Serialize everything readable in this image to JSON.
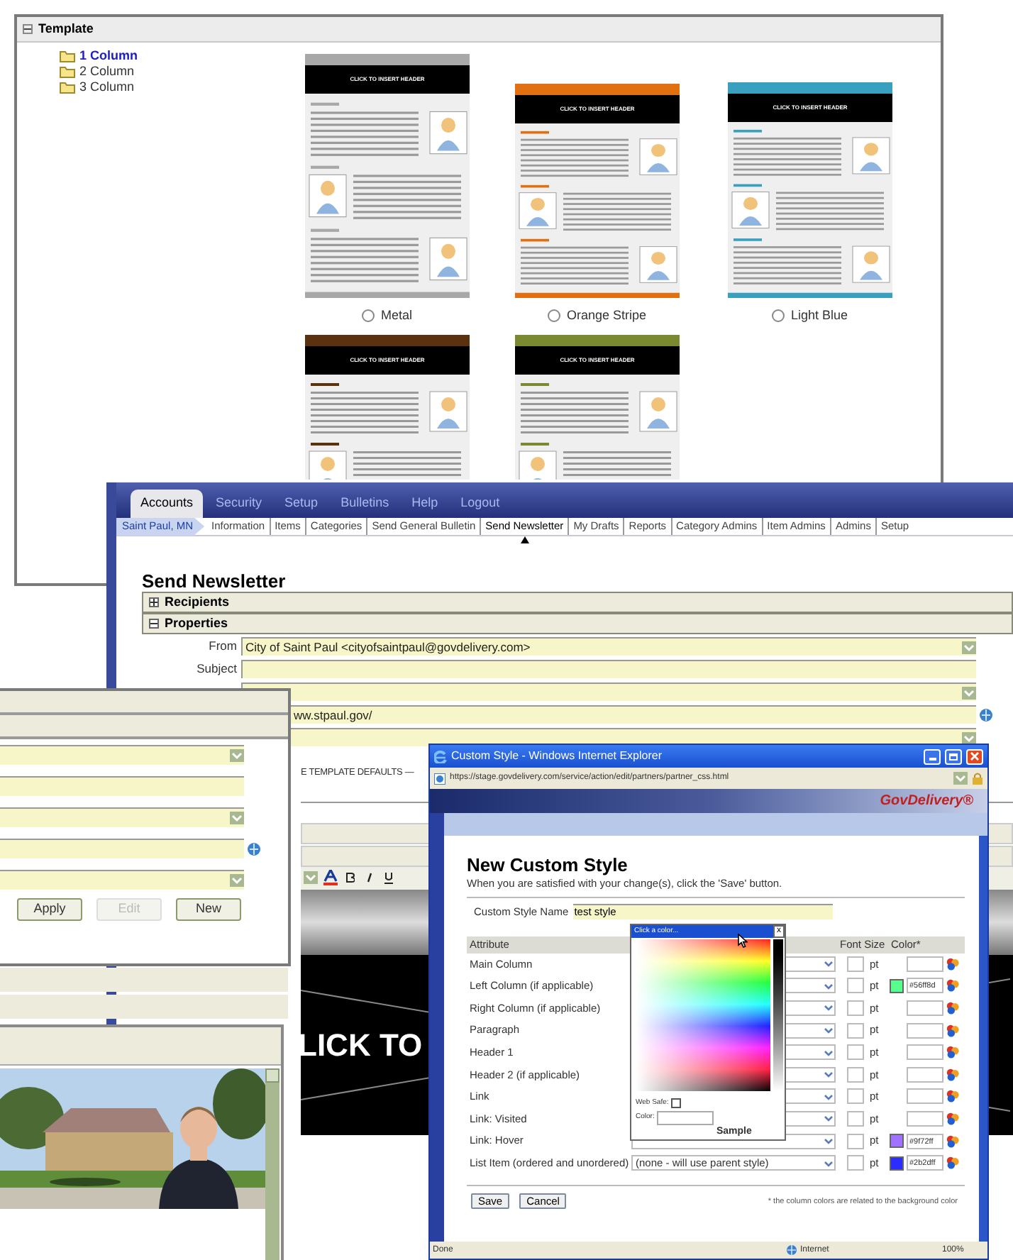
{
  "template_panel": {
    "title": "Template",
    "expanded": true,
    "tree": [
      {
        "label": "1 Column",
        "selected": true
      },
      {
        "label": "2 Column",
        "selected": false
      },
      {
        "label": "3 Column",
        "selected": false
      }
    ],
    "templates": [
      {
        "label": "Metal",
        "selected": false,
        "header_text": "CLICK TO INSERT HEADER",
        "color": "#a8a8a8"
      },
      {
        "label": "Orange Stripe",
        "selected": false,
        "header_text": "CLICK TO INSERT HEADER",
        "color": "#e07010"
      },
      {
        "label": "Light Blue",
        "selected": false,
        "header_text": "CLICK TO INSERT HEADER",
        "color": "#3aa0c0"
      },
      {
        "header_text": "CLICK TO INSERT HEADER",
        "color": "#5a3210"
      },
      {
        "header_text": "CLICK TO INSERT HEADER",
        "color": "#7a8a30"
      }
    ]
  },
  "newsletter_window": {
    "nav_tabs": [
      {
        "label": "Accounts",
        "selected": true
      },
      {
        "label": "Security",
        "selected": false
      },
      {
        "label": "Setup",
        "selected": false
      },
      {
        "label": "Bulletins",
        "selected": false
      },
      {
        "label": "Help",
        "selected": false
      },
      {
        "label": "Logout",
        "selected": false
      }
    ],
    "location": "Saint Paul, MN",
    "subnav": [
      {
        "label": "Information",
        "selected": false
      },
      {
        "label": "Items",
        "selected": false
      },
      {
        "label": "Categories",
        "selected": false
      },
      {
        "label": "Send General Bulletin",
        "selected": false
      },
      {
        "label": "Send Newsletter",
        "selected": true
      },
      {
        "label": "My Drafts",
        "selected": false
      },
      {
        "label": "Reports",
        "selected": false
      },
      {
        "label": "Category Admins",
        "selected": false
      },
      {
        "label": "Item Admins",
        "selected": false
      },
      {
        "label": "Admins",
        "selected": false
      },
      {
        "label": "Setup",
        "selected": false
      }
    ],
    "title": "Send Newsletter",
    "sections": [
      {
        "label": "Recipients",
        "expanded": false
      },
      {
        "label": "Properties",
        "expanded": true
      }
    ],
    "fields": [
      {
        "kind": "select",
        "label": "From",
        "value": "City of Saint Paul <cityofsaintpaul@govdelivery.com>"
      },
      {
        "kind": "text",
        "label": "Subject"
      },
      {
        "kind": "select"
      },
      {
        "kind": "url",
        "value": "ww.stpaul.gov/"
      },
      {
        "kind": "select"
      }
    ],
    "defaults_text": "E TEMPLATE DEFAULTS —",
    "header_image_text": "LICK TO"
  },
  "left_window": {
    "fields": [
      {
        "kind": "select"
      },
      {
        "kind": "text"
      },
      {
        "kind": "select"
      },
      {
        "kind": "url"
      },
      {
        "kind": "select"
      }
    ],
    "buttons": [
      {
        "label": "Apply",
        "disabled": false
      },
      {
        "label": "Edit",
        "disabled": true
      },
      {
        "label": "New",
        "disabled": false
      }
    ]
  },
  "custom_style_window": {
    "title": "Custom Style - Windows Internet Explorer",
    "address": "https://stage.govdelivery.com/service/action/edit/partners/partner_css.html",
    "brand": "GovDelivery®",
    "heading": "New Custom Style",
    "subtitle": "When you are satisfied with your change(s), click the 'Save' button.",
    "name_label": "Custom Style Name",
    "name_value": "test style",
    "columns": [
      "Attribute",
      "Font Size",
      "Color*"
    ],
    "rows": [
      {
        "attribute": "Main Column",
        "unit": "pt"
      },
      {
        "attribute": "Left Column (if applicable)",
        "unit": "pt",
        "color": "#56ff8d",
        "color_value": "#56ff8d"
      },
      {
        "attribute": "Right Column (if applicable)",
        "unit": "pt"
      },
      {
        "attribute": "Paragraph",
        "unit": "pt"
      },
      {
        "attribute": "Header 1",
        "unit": "pt"
      },
      {
        "attribute": "Header 2 (if applicable)",
        "unit": "pt"
      },
      {
        "attribute": "Link",
        "unit": "pt"
      },
      {
        "attribute": "Link: Visited",
        "unit": "pt"
      },
      {
        "attribute": "Link: Hover",
        "unit": "pt",
        "color": "#9f72ff",
        "color_value": "#9f72ff"
      },
      {
        "attribute": "List Item (ordered and unordered)",
        "style": "(none - will use parent style)",
        "unit": "pt",
        "color": "#2b2dff",
        "color_value": "#2b2dff"
      }
    ],
    "buttons": [
      "Save",
      "Cancel"
    ],
    "footnote": "* the column colors are related to the background color",
    "picker": {
      "title": "Click a color...",
      "close": "x",
      "web_safe_label": "Web Safe:",
      "web_safe": false,
      "color_label": "Color:",
      "sample": "Sample"
    },
    "status": {
      "text": "Done",
      "zone": "Internet",
      "zoom": "100%"
    }
  }
}
